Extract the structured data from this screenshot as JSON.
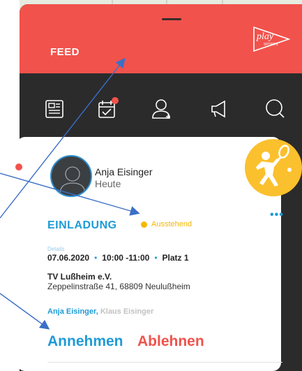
{
  "header": {
    "title": "FEED",
    "logo_text": "play",
    "logo_subtext": "SPORTS"
  },
  "tabs": [
    {
      "icon": "newspaper-icon",
      "badge": false
    },
    {
      "icon": "calendar-check-icon",
      "badge": true
    },
    {
      "icon": "add-person-icon",
      "badge": false
    },
    {
      "icon": "megaphone-icon",
      "badge": false
    },
    {
      "icon": "search-icon",
      "badge": false
    }
  ],
  "card": {
    "user_name": "Anja Eisinger",
    "time": "Heute",
    "more": "•••",
    "invite_label": "EINLADUNG",
    "status": "Ausstehend",
    "details_label": "Details",
    "date": "07.06.2020",
    "time_range": "10:00 -11:00",
    "court": "Platz 1",
    "sep": "•",
    "club": "TV Lußheim e.V.",
    "address": "Zeppelinstraße 41, 68809 Neulußheim",
    "player1": "Anja Eisinger,",
    "player2": "Klaus Eisinger",
    "accept": "Annehmen",
    "decline": "Ablehnen"
  },
  "colors": {
    "header": "#f1524c",
    "accent": "#1e9bd7",
    "pending": "#f5b800",
    "dark": "#2b2b2c",
    "sport_badge": "#fbc02d"
  }
}
